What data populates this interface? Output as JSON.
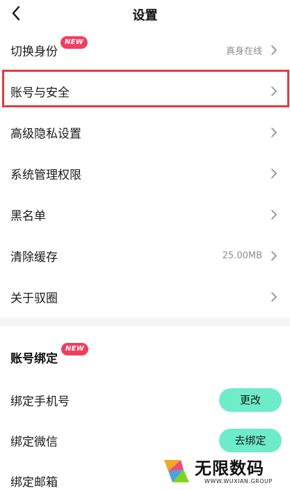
{
  "header": {
    "title": "设置"
  },
  "items": [
    {
      "label": "切换身份",
      "value": "真身在线",
      "badge": "NEW"
    },
    {
      "label": "账号与安全",
      "value": ""
    },
    {
      "label": "高级隐私设置",
      "value": ""
    },
    {
      "label": "系统管理权限",
      "value": ""
    },
    {
      "label": "黑名单",
      "value": ""
    },
    {
      "label": "清除缓存",
      "value": "25.00MB"
    },
    {
      "label": "关于驭圈",
      "value": ""
    }
  ],
  "binding": {
    "title": "账号绑定",
    "badge": "NEW",
    "rows": [
      {
        "label": "绑定手机号",
        "action": "更改"
      },
      {
        "label": "绑定微信",
        "action": "去绑定"
      },
      {
        "label": "绑定邮箱",
        "action": ""
      }
    ]
  },
  "watermark": {
    "name": "无限数码",
    "sub": "WWW.WUXIAN.GROUP"
  },
  "colors": {
    "accent_pill": "#6eecca",
    "badge": "#f03f5e",
    "highlight": "#e8393f"
  }
}
